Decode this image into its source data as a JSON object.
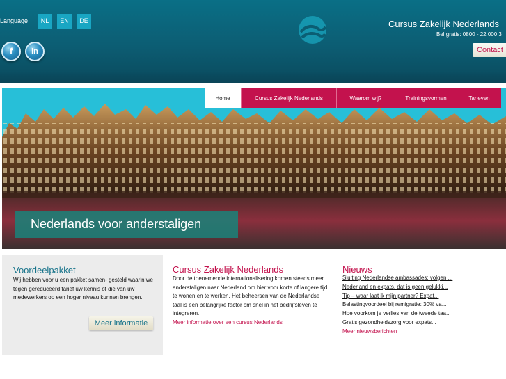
{
  "header": {
    "language_label": "Language",
    "languages": [
      "NL",
      "EN",
      "DE"
    ],
    "social": {
      "facebook": "f",
      "linkedin": "in"
    },
    "site_title": "Cursus Zakelijk Nederlands",
    "phone": "Bel gratis: 0800 - 22 000 3",
    "contact_label": "Contact"
  },
  "nav": {
    "items": [
      "Home",
      "Cursus Zakelijk Nederlands",
      "Waarom wij?",
      "Trainingsvormen",
      "Tarieven"
    ],
    "active": "Home"
  },
  "banner": {
    "caption": "Nederlands voor anderstaligen"
  },
  "voordeel": {
    "title": "Voordeelpakket",
    "text": "Wij hebben voor u een pakket samen- gesteld waarin we tegen gereduceerd tarief uw kennis of die van uw medewerkers op een hoger niveau kunnen brengen.",
    "button_label": "Meer informatie"
  },
  "cursus": {
    "title": "Cursus Zakelijk Nederlands",
    "text": "Door de toenemende internationalisering komen steeds meer anderstaligen naar Nederland om hier voor korte of langere tijd te wonen en te werken. Het beheersen van de Nederlandse taal is een belangrijke factor om snel in het bedrijfsleven te integreren.",
    "link": "Meer informatie over een cursus Nederlands"
  },
  "nieuws": {
    "title": "Nieuws",
    "items": [
      "Sluiting Nederlandse ambassades: volgen ...",
      "Nederland en expats, dat is geen gelukki...",
      "Tip – waar laat ik mijn partner? Expat...",
      "Belastingvoordeel bij remigratie: 30% va...",
      "Hoe voorkom je verlies van de tweede taa...",
      "Gratis gezondheidszorg voor expats..."
    ],
    "more_link": "Meer nieuwsberichten"
  },
  "colors": {
    "header_teal": "#0c5d73",
    "accent_pink": "#c3124d",
    "lang_button": "#19a6c3",
    "heading_teal": "#17738a"
  }
}
